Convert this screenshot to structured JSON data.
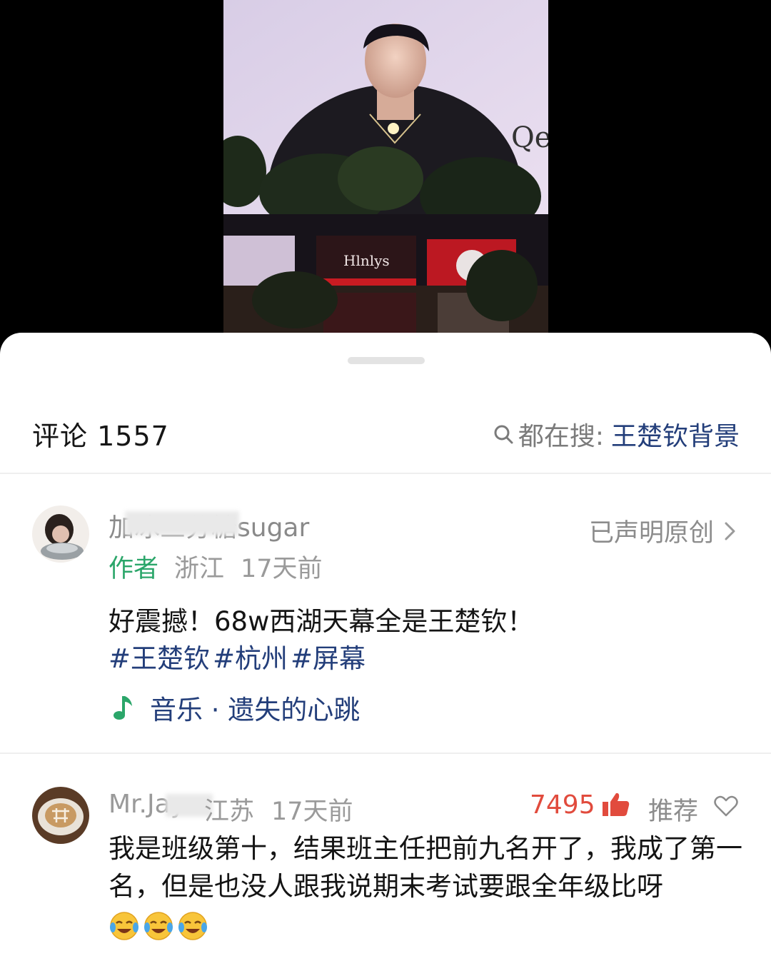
{
  "comments_header": {
    "label": "评论",
    "count": "1557",
    "hot_search_prefix": "都在搜:",
    "hot_search_keyword": "王楚钦背景"
  },
  "author_post": {
    "username": "加冰三分糖sugar",
    "author_badge": "作者",
    "location": "浙江",
    "time": "17天前",
    "declared_original": "已声明原创",
    "text": "好震撼！68w西湖天幕全是王楚钦！",
    "hashtags": [
      "#王楚钦",
      "#杭州",
      "#屏幕"
    ],
    "music_label": "音乐 · 遗失的心跳"
  },
  "comments": [
    {
      "username": "Mr.Jay",
      "location": "江苏",
      "time": "17天前",
      "likes": "7495",
      "recommend": "推荐",
      "text": "我是班级第十，结果班主任把前九名开了，我成了第一名，但是也没人跟我说期末考试要跟全年级比呀"
    }
  ],
  "billboard_text": "Qe",
  "colors": {
    "accent_link": "#233e7a",
    "author_green": "#2ba66a",
    "like_red": "#e14b3d"
  }
}
